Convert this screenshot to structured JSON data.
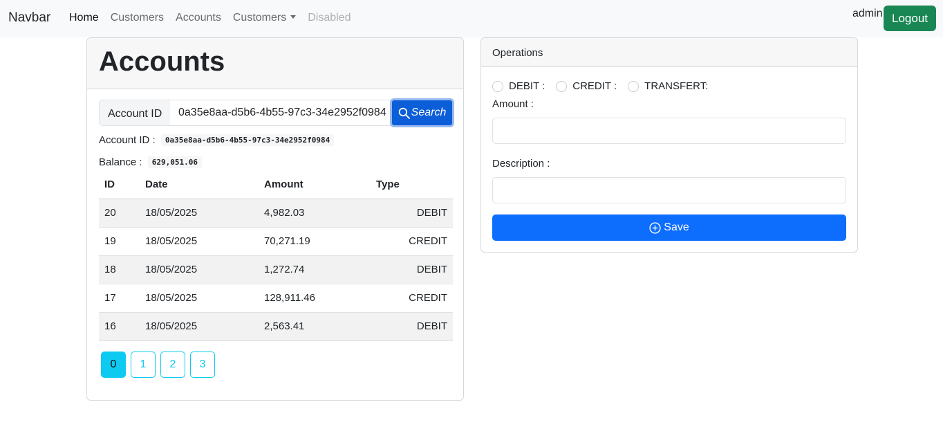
{
  "navbar": {
    "brand": "Navbar",
    "items": [
      {
        "label": "Home"
      },
      {
        "label": "Customers"
      },
      {
        "label": "Accounts"
      },
      {
        "label": "Customers"
      },
      {
        "label": "Disabled"
      }
    ],
    "username": "admin",
    "logout_label": "Logout"
  },
  "accounts": {
    "title": "Accounts",
    "search_label": "Account ID",
    "search_value": "0a35e8aa-d5b6-4b55-97c3-34e2952f0984",
    "search_button": "Search",
    "account_id_label": "Account ID :",
    "account_id_value": "0a35e8aa-d5b6-4b55-97c3-34e2952f0984",
    "balance_label": "Balance :",
    "balance_value": "629,051.06",
    "table": {
      "headers": [
        "ID",
        "Date",
        "Amount",
        "Type"
      ],
      "rows": [
        [
          "20",
          "18/05/2025",
          "4,982.03",
          "DEBIT"
        ],
        [
          "19",
          "18/05/2025",
          "70,271.19",
          "CREDIT"
        ],
        [
          "18",
          "18/05/2025",
          "1,272.74",
          "DEBIT"
        ],
        [
          "17",
          "18/05/2025",
          "128,911.46",
          "CREDIT"
        ],
        [
          "16",
          "18/05/2025",
          "2,563.41",
          "DEBIT"
        ]
      ]
    },
    "pages": [
      "0",
      "1",
      "2",
      "3"
    ]
  },
  "operations": {
    "title": "Operations",
    "radios": [
      "DEBIT :",
      "CREDIT :",
      "TRANSFERT:"
    ],
    "amount_label": "Amount :",
    "description_label": "Description :",
    "save_label": "Save"
  },
  "colors": {
    "primary": "#0d6efd",
    "success": "#198754",
    "info": "#0dcaf0",
    "navbar_bg": "#f8f9fa"
  }
}
